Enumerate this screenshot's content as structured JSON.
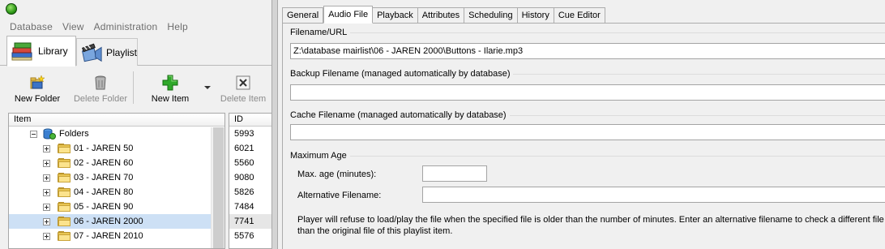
{
  "menubar": [
    "Database",
    "View",
    "Administration",
    "Help"
  ],
  "main_tabs": {
    "library": "Library",
    "playlist": "Playlist"
  },
  "toolbar": {
    "new_folder": "New Folder",
    "delete_folder": "Delete Folder",
    "new_item": "New Item",
    "delete_item": "Delete Item"
  },
  "tree": {
    "header_item": "Item",
    "header_id": "ID",
    "root": "Folders",
    "rows": [
      {
        "label": "01 - JAREN 50",
        "id": "6021"
      },
      {
        "label": "02 - JAREN 60",
        "id": "5560"
      },
      {
        "label": "03 - JAREN 70",
        "id": "9080"
      },
      {
        "label": "04 - JAREN 80",
        "id": "5826"
      },
      {
        "label": "05 - JAREN 90",
        "id": "7484"
      },
      {
        "label": "06 - JAREN 2000",
        "id": "7741"
      },
      {
        "label": "07 - JAREN 2010",
        "id": "5576"
      }
    ],
    "root_id": "5993",
    "selected_index": 5
  },
  "detail_tabs": [
    "General",
    "Audio File",
    "Playback",
    "Attributes",
    "Scheduling",
    "History",
    "Cue Editor"
  ],
  "active_tab": "Audio File",
  "audio_file": {
    "filename_group": "Filename/URL",
    "filename_value": "Z:\\database mairlist\\06 - JAREN 2000\\Buttons - Ilarie.mp3",
    "backup_group": "Backup Filename (managed automatically by database)",
    "backup_value": "",
    "cache_group": "Cache Filename (managed automatically by database)",
    "cache_value": "",
    "max_age_group": "Maximum Age",
    "max_age_label": "Max. age (minutes):",
    "max_age_value": "",
    "alt_filename_label": "Alternative Filename:",
    "alt_filename_value": "",
    "help": "Player will refuse to load/play the file when the specified file is older than the number of minutes. Enter an alternative filename to check a different file than the original file of this playlist item."
  },
  "colors": {
    "selection": "#cde0f5",
    "folder": "#e8c552",
    "new_item_green": "#2fa82a"
  }
}
